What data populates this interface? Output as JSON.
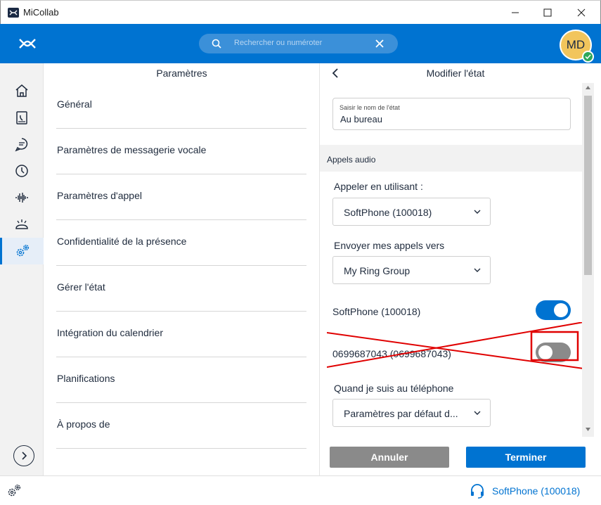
{
  "window": {
    "title": "MiCollab",
    "minimize_icon": "minimize-icon",
    "maximize_icon": "maximize-icon",
    "close_icon": "close-icon"
  },
  "header": {
    "search_placeholder": "Rechercher ou numéroter",
    "avatar_initials": "MD",
    "presence_color": "#2da85a",
    "background": "#0073d1"
  },
  "rail": {
    "items": [
      {
        "icon": "home-icon"
      },
      {
        "icon": "contacts-book-icon"
      },
      {
        "icon": "chat-icon"
      },
      {
        "icon": "history-clock-icon"
      },
      {
        "icon": "voicemail-waveform-icon"
      },
      {
        "icon": "conference-phone-icon"
      },
      {
        "icon": "settings-gears-icon",
        "active": true
      }
    ],
    "expand_icon": "chevron-right-icon"
  },
  "settings": {
    "title": "Paramètres",
    "items": [
      "Général",
      "Paramètres de messagerie vocale",
      "Paramètres d'appel",
      "Confidentialité de la présence",
      "Gérer l'état",
      "Intégration du calendrier",
      "Planifications",
      "À propos de"
    ]
  },
  "state_editor": {
    "title": "Modifier l'état",
    "name_label": "Saisir le nom de l'état",
    "name_value": "Au bureau",
    "section_title": "Appels audio",
    "call_using_label": "Appeler en utilisant :",
    "call_using_value": "SoftPhone (100018)",
    "send_calls_label": "Envoyer mes appels vers",
    "send_calls_value": "My Ring Group",
    "device_1_label": "SoftPhone (100018)",
    "device_1_enabled": true,
    "device_2_label": "0699687043 (0699687043)",
    "device_2_enabled": false,
    "on_phone_label": "Quand je suis au téléphone",
    "on_phone_value": "Paramètres par défaut d...",
    "cancel_label": "Annuler",
    "done_label": "Terminer",
    "annotation_color": "#e00000"
  },
  "statusbar": {
    "device_label": "SoftPhone (100018)",
    "accent": "#0073d1"
  }
}
